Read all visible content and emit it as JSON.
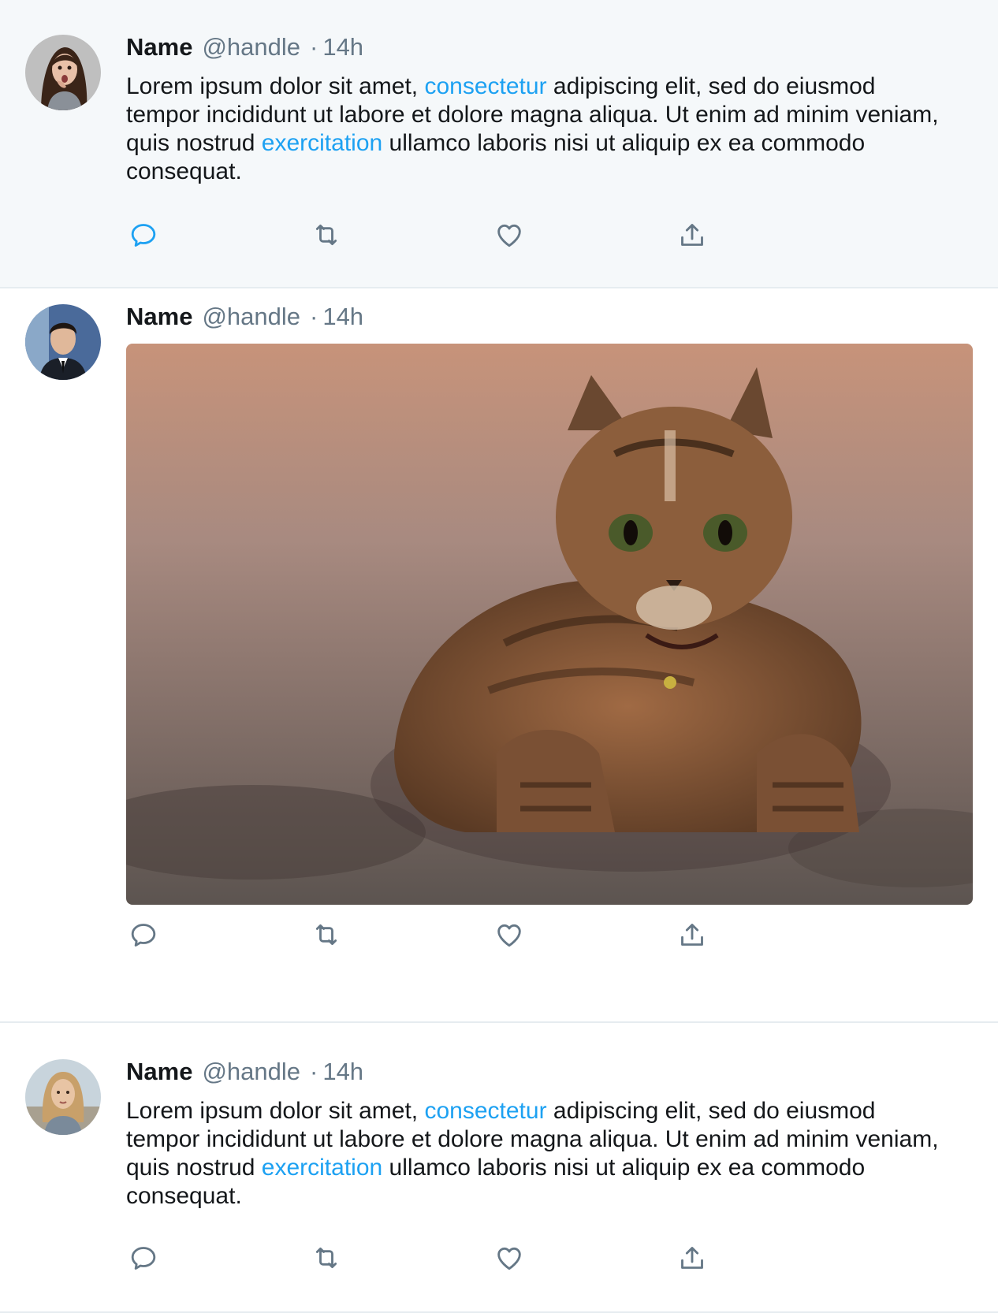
{
  "tweets": [
    {
      "name": "Name",
      "handle": "@handle",
      "separator": "·",
      "time": "14h",
      "text": [
        {
          "t": "Lorem ipsum dolor sit amet, ",
          "link": false
        },
        {
          "t": "consectetur",
          "link": true
        },
        {
          "t": " adipiscing elit, sed do eiusmod tempor incididunt ut labore et dolore magna aliqua. Ut enim ad minim veniam, quis nostrud ",
          "link": false
        },
        {
          "t": "exercitation",
          "link": true
        },
        {
          "t": " ullamco laboris nisi ut aliquip ex ea commodo consequat.",
          "link": false
        }
      ],
      "highlighted": true
    },
    {
      "name": "Name",
      "handle": "@handle",
      "separator": "·",
      "time": "14h",
      "media": "photo of a tabby kitten lying on sand"
    },
    {
      "name": "Name",
      "handle": "@handle",
      "separator": "·",
      "time": "14h",
      "text": [
        {
          "t": "Lorem ipsum dolor sit amet, ",
          "link": false
        },
        {
          "t": "consectetur",
          "link": true
        },
        {
          "t": " adipiscing elit, sed do eiusmod tempor incididunt ut labore et dolore magna aliqua. Ut enim ad minim veniam, quis nostrud ",
          "link": false
        },
        {
          "t": "exercitation",
          "link": true
        },
        {
          "t": " ullamco laboris nisi ut aliquip ex ea commodo consequat.",
          "link": false
        }
      ]
    }
  ],
  "actions": [
    "reply-icon",
    "retweet-icon",
    "like-icon",
    "share-icon"
  ],
  "colors": {
    "link": "#1da1f2",
    "secondary_text": "#657786",
    "icon": "#657786",
    "icon_active": "#1da1f2",
    "highlight_bg": "#f5f8fa",
    "divider": "#e6ecf0"
  }
}
